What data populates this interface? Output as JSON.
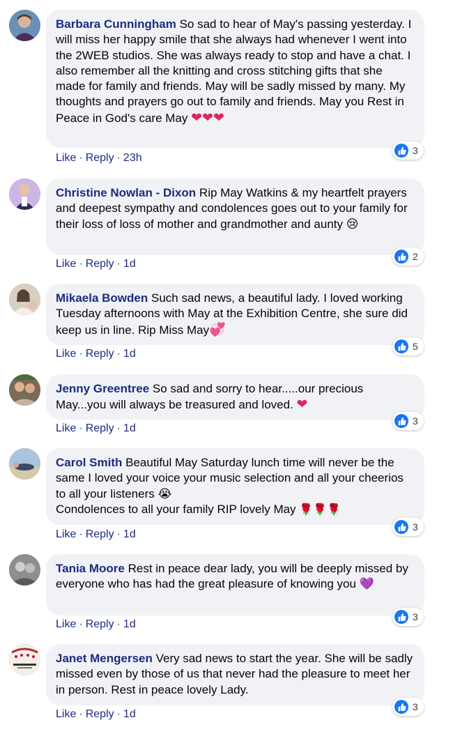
{
  "actions": {
    "like": "Like",
    "reply": "Reply",
    "sep": "·"
  },
  "colors": {
    "author": "#1c2b80",
    "bubble": "#f0f2f5",
    "like_badge": "#1877f2"
  },
  "comments": [
    {
      "author": "Barbara Cunningham",
      "text": " So sad to hear of May's passing yesterday. I will miss her happy smile that she always had whenever I went into the 2WEB studios. She was always ready to stop and have a chat. I also remember all the knitting and cross stitching gifts that she made for family and friends. May will be sadly missed by many. My thoughts and prayers go out to family and friends. May you Rest in Peace in God's care May ",
      "emoji": "❤❤❤",
      "emoji_icon": "heart-icon",
      "time": "23h",
      "reactions": "3"
    },
    {
      "author": "Christine Nowlan - Dixon",
      "text": " Rip May Watkins & my heartfelt prayers and deepest sympathy and condolences goes out to your family for their loss of loss of mother and grandmother and aunty ",
      "emoji": "😢",
      "emoji_icon": "crying-face-icon",
      "time": "1d",
      "reactions": "2"
    },
    {
      "author": "Mikaela Bowden",
      "text": " Such sad news, a beautiful lady. I loved working Tuesday afternoons with May at the Exhibition Centre, she sure did keep us in line. Rip Miss May",
      "emoji": "💞",
      "emoji_icon": "hearts-icon",
      "time": "1d",
      "reactions": "5"
    },
    {
      "author": "Jenny Greentree",
      "text": " So sad and sorry to hear.....our precious May...you will always be treasured and loved. ",
      "emoji": "❤",
      "emoji_icon": "heart-icon",
      "time": "1d",
      "reactions": "3"
    },
    {
      "author": "Carol Smith",
      "text": " Beautiful May Saturday lunch time will never be the same I loved your voice your music selection and all your cheerios to all your listeners ",
      "emoji": "😭",
      "emoji_icon": "sobbing-face-icon",
      "text2": "Condolences to all your family RIP lovely May ",
      "emoji2": "🌹🌹🌹",
      "emoji2_icon": "rose-icon",
      "time": "1d",
      "reactions": "3"
    },
    {
      "author": "Tania Moore",
      "text": " Rest in peace dear lady, you will be deeply missed by everyone who has had the great pleasure of knowing you ",
      "emoji": "💜",
      "emoji_icon": "purple-heart-icon",
      "time": "1d",
      "reactions": "3"
    },
    {
      "author": "Janet Mengersen",
      "text": " Very sad news to start the year. She will be sadly missed even by those of us that never had the pleasure to meet her in person. Rest in peace lovely Lady.",
      "time": "1d",
      "reactions": "3"
    }
  ]
}
